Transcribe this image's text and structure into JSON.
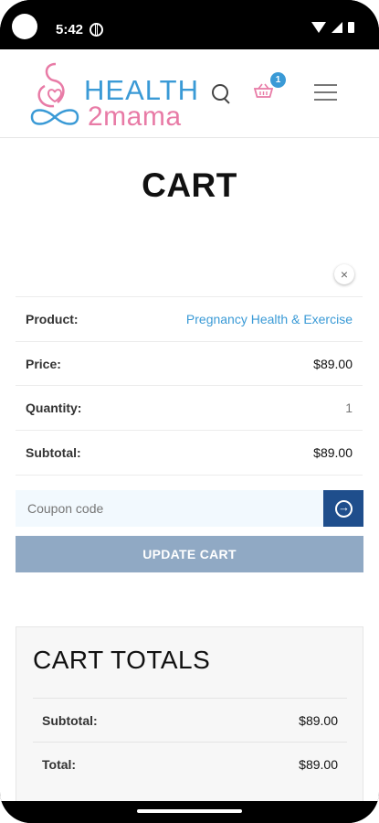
{
  "status": {
    "time": "5:42"
  },
  "brand": {
    "line1": "HEALTH",
    "line2": "2mama",
    "primary_color": "#3a9ad6",
    "accent_color": "#e87ba6"
  },
  "header": {
    "cart_count": "1",
    "icons": [
      "search-icon",
      "basket-icon",
      "menu-icon"
    ]
  },
  "page": {
    "title": "CART"
  },
  "cart_item": {
    "remove_symbol": "×",
    "rows": [
      {
        "label": "Product:",
        "value": "Pregnancy Health & Exercise"
      },
      {
        "label": "Price:",
        "value": "$89.00"
      },
      {
        "label": "Quantity:",
        "value": "1"
      },
      {
        "label": "Subtotal:",
        "value": "$89.00"
      }
    ]
  },
  "coupon": {
    "placeholder": "Coupon code"
  },
  "buttons": {
    "update_cart": "UPDATE CART"
  },
  "totals": {
    "title": "CART TOTALS",
    "rows": [
      {
        "label": "Subtotal:",
        "value": "$89.00"
      },
      {
        "label": "Total:",
        "value": "$89.00"
      }
    ]
  }
}
